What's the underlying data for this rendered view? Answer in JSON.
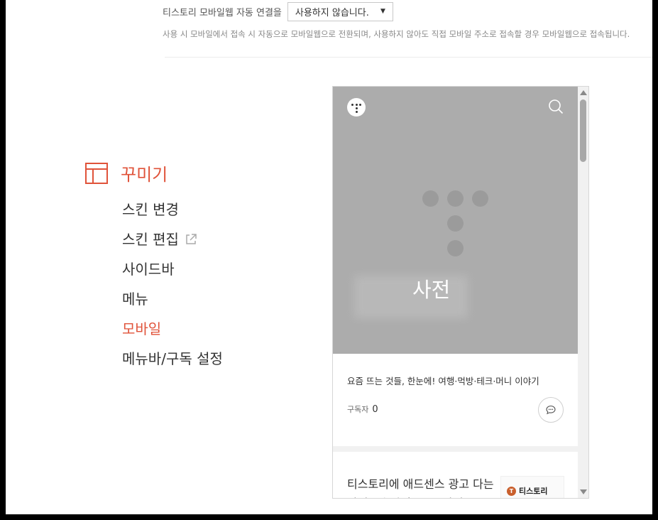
{
  "settings": {
    "mobile_auto_label": "티스토리 모바일웹 자동 연결을",
    "mobile_auto_value": "사용하지 않습니다.",
    "mobile_auto_desc": "사용 시 모바일에서 접속 시 자동으로 모바일웹으로 전환되며, 사용하지 않아도 직접 모바일 주소로 접속할 경우 모바일웹으로 접속됩니다."
  },
  "nav": {
    "section_title": "꾸미기",
    "items": [
      {
        "label": "스킨 변경"
      },
      {
        "label": "스킨 편집"
      },
      {
        "label": "사이드바"
      },
      {
        "label": "메뉴"
      },
      {
        "label": "모바일"
      },
      {
        "label": "메뉴바/구독 설정"
      }
    ],
    "active_item": "모바일"
  },
  "preview": {
    "blog_title": "사전",
    "description": "요즘 뜨는 것들, 한눈에! 여행·먹방·테크·머니 이야기",
    "subscribers_label": "구독자",
    "subscribers_count": "0",
    "post_title": "티스토리에 애드센스 광고 다는 방법 - 승인 후 코드 삽입",
    "post_thumb_label": "티스토리",
    "post_thumb_logo": "T"
  },
  "colors": {
    "accent": "#e0533a",
    "hero_bg": "#acacac"
  }
}
